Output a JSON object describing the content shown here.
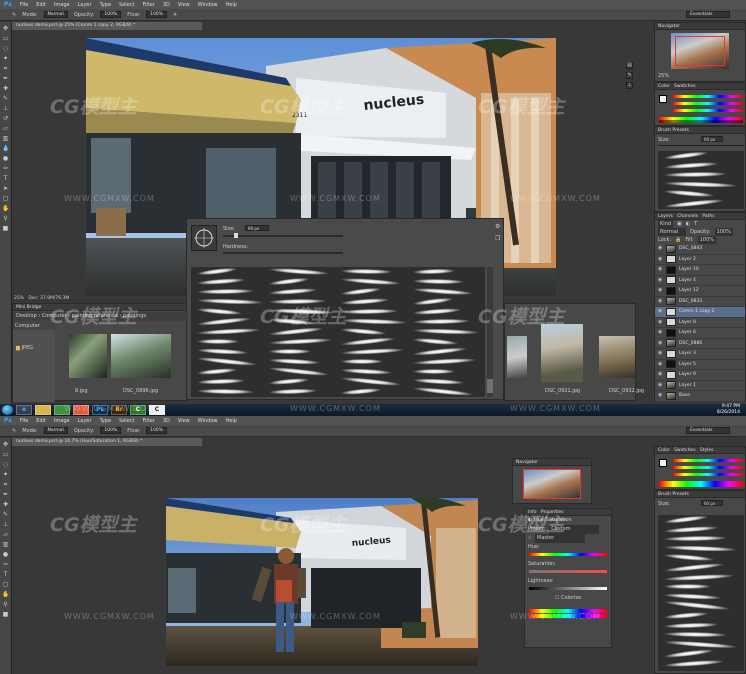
{
  "watermark": {
    "brand": "CG模型主",
    "url": "WWW.CGMXW.COM"
  },
  "top": {
    "menu": [
      "File",
      "Edit",
      "Image",
      "Layer",
      "Type",
      "Select",
      "Filter",
      "3D",
      "View",
      "Window",
      "Help"
    ],
    "options": {
      "mode_label": "Mode:",
      "mode_value": "Normal",
      "opacity_label": "Opacity:",
      "opacity_value": "100%",
      "flow_label": "Flow:",
      "flow_value": "100%",
      "workspace": "Essentials"
    },
    "doc_tab": "nucleus demo.psd @ 25% (Comm 1 copy 2, RGB/8) *",
    "status": {
      "zoom": "25%",
      "doc": "Doc: 37.9M/76.3M"
    },
    "navigator": {
      "title": "Navigator",
      "zoom": "25%"
    },
    "color_panel": {
      "tab1": "Color",
      "tab2": "Swatches"
    },
    "brush_presets": {
      "title": "Brush Presets",
      "size_label": "Size:",
      "size_value": "60 px"
    },
    "brush_picker": {
      "size_label": "Size:",
      "size_value": "60 px",
      "hardness_label": "Hardness:"
    },
    "layers": {
      "tabs": [
        "Layers",
        "Channels",
        "Paths"
      ],
      "kind": "Kind",
      "mode": "Normal",
      "opacity_label": "Opacity:",
      "opacity_value": "100%",
      "lock_label": "Lock:",
      "fill_label": "Fill:",
      "fill_value": "100%",
      "rows": [
        {
          "name": "DSC_0843",
          "thumb": "photo"
        },
        {
          "name": "Layer 2",
          "thumb": "light"
        },
        {
          "name": "Layer 10",
          "thumb": "dark"
        },
        {
          "name": "Layer 4",
          "thumb": "light"
        },
        {
          "name": "Layer 12",
          "thumb": "dark"
        },
        {
          "name": "DSC_0833",
          "thumb": "photo"
        },
        {
          "name": "Comm 1 copy 2",
          "thumb": "light"
        },
        {
          "name": "Layer 8",
          "thumb": "light"
        },
        {
          "name": "Layer 6",
          "thumb": "dark"
        },
        {
          "name": "DSC_0886",
          "thumb": "photo"
        },
        {
          "name": "Layer 3",
          "thumb": "light"
        },
        {
          "name": "Layer 5",
          "thumb": "dark"
        },
        {
          "name": "Layer 9",
          "thumb": "light"
        },
        {
          "name": "Layer 1",
          "thumb": "photo"
        },
        {
          "name": "Base",
          "thumb": "photo"
        }
      ]
    },
    "mini_bridge": {
      "title": "Mini Bridge",
      "tab": "Computer",
      "path": [
        "Desktop",
        "Computer",
        "painting reference",
        "paintings"
      ],
      "tree_item": "JPEG",
      "thumbs": [
        "8.jpg",
        "DSC_0896.jpg",
        "DSC_0921.jpg",
        "DSC_0932.jpg"
      ]
    },
    "building_sign": "nucleus",
    "building_number": "2311"
  },
  "taskbar": {
    "apps": [
      "e",
      "",
      "",
      "",
      "Ps",
      "Br",
      "C",
      "C"
    ],
    "time": "9:47 PM",
    "date": "8/26/2014"
  },
  "bottom": {
    "menu": [
      "File",
      "Edit",
      "Image",
      "Layer",
      "Type",
      "Select",
      "Filter",
      "3D",
      "View",
      "Window",
      "Help"
    ],
    "options": {
      "mode_label": "Mode:",
      "mode_value": "Normal",
      "opacity_label": "Opacity:",
      "opacity_value": "100%",
      "flow_label": "Flow:",
      "flow_value": "100%",
      "workspace": "Essentials"
    },
    "doc_tab": "nucleus demo.psd @ 16.7% (Hue/Saturation 1, RGB/8) *",
    "navigator": {
      "title": "Navigator"
    },
    "color_panel": {
      "tab1": "Color",
      "tab2": "Swatches",
      "tab3": "Styles"
    },
    "brush_presets": {
      "title": "Brush Presets",
      "size_label": "Size:",
      "size_value": "60 px"
    },
    "properties": {
      "tab1": "Info",
      "tab2": "Properties",
      "title": "Hue/Saturation",
      "preset_label": "Preset:",
      "preset_value": "Custom",
      "channel": "Master",
      "hue_label": "Hue:",
      "saturation_label": "Saturation:",
      "lightness_label": "Lightness:",
      "colorize": "Colorize"
    },
    "building_sign": "nucleus"
  }
}
